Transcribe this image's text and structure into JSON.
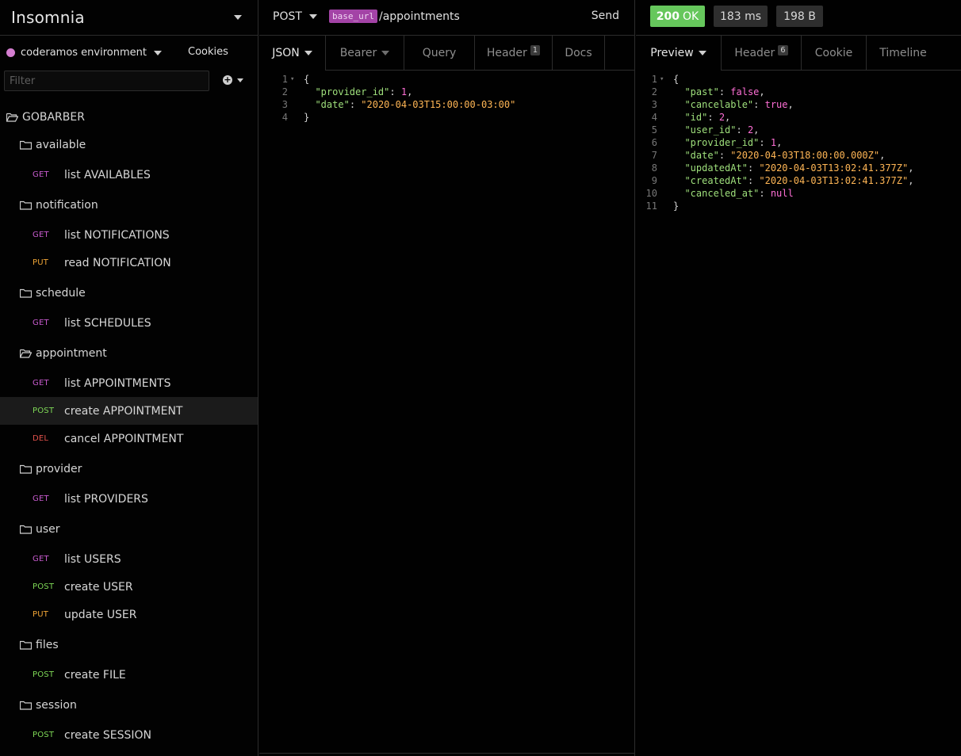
{
  "app": {
    "title": "Insomnia"
  },
  "environment": {
    "name": "coderamos environment",
    "cookies_label": "Cookies",
    "color": "#d47ed0"
  },
  "filter": {
    "placeholder": "Filter"
  },
  "workspace": {
    "name": "GOBARBER"
  },
  "method_colors": {
    "GET": "#c75bce",
    "POST": "#7fd957",
    "PUT": "#f0a536",
    "DEL": "#e2524c"
  },
  "tree": [
    {
      "type": "folder",
      "label": "available",
      "open": false
    },
    {
      "type": "request",
      "method": "GET",
      "label": "list AVAILABLES"
    },
    {
      "type": "folder",
      "label": "notification",
      "open": false
    },
    {
      "type": "request",
      "method": "GET",
      "label": "list NOTIFICATIONS"
    },
    {
      "type": "request",
      "method": "PUT",
      "label": "read NOTIFICATION"
    },
    {
      "type": "folder",
      "label": "schedule",
      "open": false
    },
    {
      "type": "request",
      "method": "GET",
      "label": "list SCHEDULES"
    },
    {
      "type": "folder",
      "label": "appointment",
      "open": true
    },
    {
      "type": "request",
      "method": "GET",
      "label": "list APPOINTMENTS"
    },
    {
      "type": "request",
      "method": "POST",
      "label": "create APPOINTMENT",
      "active": true
    },
    {
      "type": "request",
      "method": "DEL",
      "label": "cancel APPOINTMENT"
    },
    {
      "type": "folder",
      "label": "provider",
      "open": false
    },
    {
      "type": "request",
      "method": "GET",
      "label": "list PROVIDERS"
    },
    {
      "type": "folder",
      "label": "user",
      "open": false
    },
    {
      "type": "request",
      "method": "GET",
      "label": "list USERS"
    },
    {
      "type": "request",
      "method": "POST",
      "label": "create USER"
    },
    {
      "type": "request",
      "method": "PUT",
      "label": "update USER"
    },
    {
      "type": "folder",
      "label": "files",
      "open": false
    },
    {
      "type": "request",
      "method": "POST",
      "label": "create FILE"
    },
    {
      "type": "folder",
      "label": "session",
      "open": false
    },
    {
      "type": "request",
      "method": "POST",
      "label": "create SESSION"
    }
  ],
  "request": {
    "method": "POST",
    "base_url_tag": "base_url",
    "url_path": "/appointments",
    "send_label": "Send",
    "tabs": {
      "body": "JSON",
      "auth": "Bearer",
      "query": "Query",
      "header": "Header",
      "header_count": "1",
      "docs": "Docs"
    },
    "body_lines": [
      [
        [
          "p",
          "{"
        ]
      ],
      [
        [
          "p",
          "  "
        ],
        [
          "k",
          "\"provider_id\""
        ],
        [
          "p",
          ": "
        ],
        [
          "n",
          "1"
        ],
        [
          "p",
          ","
        ]
      ],
      [
        [
          "p",
          "  "
        ],
        [
          "k",
          "\"date\""
        ],
        [
          "p",
          ": "
        ],
        [
          "s",
          "\"2020-04-03T15:00:00-03:00\""
        ]
      ],
      [
        [
          "p",
          "}"
        ]
      ]
    ]
  },
  "response": {
    "status_code": "200",
    "status_text": "OK",
    "time": "183 ms",
    "size": "198 B",
    "tabs": {
      "preview": "Preview",
      "header": "Header",
      "header_count": "6",
      "cookie": "Cookie",
      "timeline": "Timeline"
    },
    "body_lines": [
      [
        [
          "p",
          "{"
        ]
      ],
      [
        [
          "p",
          "  "
        ],
        [
          "k",
          "\"past\""
        ],
        [
          "p",
          ": "
        ],
        [
          "b",
          "false"
        ],
        [
          "p",
          ","
        ]
      ],
      [
        [
          "p",
          "  "
        ],
        [
          "k",
          "\"cancelable\""
        ],
        [
          "p",
          ": "
        ],
        [
          "b",
          "true"
        ],
        [
          "p",
          ","
        ]
      ],
      [
        [
          "p",
          "  "
        ],
        [
          "k",
          "\"id\""
        ],
        [
          "p",
          ": "
        ],
        [
          "n",
          "2"
        ],
        [
          "p",
          ","
        ]
      ],
      [
        [
          "p",
          "  "
        ],
        [
          "k",
          "\"user_id\""
        ],
        [
          "p",
          ": "
        ],
        [
          "n",
          "2"
        ],
        [
          "p",
          ","
        ]
      ],
      [
        [
          "p",
          "  "
        ],
        [
          "k",
          "\"provider_id\""
        ],
        [
          "p",
          ": "
        ],
        [
          "n",
          "1"
        ],
        [
          "p",
          ","
        ]
      ],
      [
        [
          "p",
          "  "
        ],
        [
          "k",
          "\"date\""
        ],
        [
          "p",
          ": "
        ],
        [
          "s",
          "\"2020-04-03T18:00:00.000Z\""
        ],
        [
          "p",
          ","
        ]
      ],
      [
        [
          "p",
          "  "
        ],
        [
          "k",
          "\"updatedAt\""
        ],
        [
          "p",
          ": "
        ],
        [
          "s",
          "\"2020-04-03T13:02:41.377Z\""
        ],
        [
          "p",
          ","
        ]
      ],
      [
        [
          "p",
          "  "
        ],
        [
          "k",
          "\"createdAt\""
        ],
        [
          "p",
          ": "
        ],
        [
          "s",
          "\"2020-04-03T13:02:41.377Z\""
        ],
        [
          "p",
          ","
        ]
      ],
      [
        [
          "p",
          "  "
        ],
        [
          "k",
          "\"canceled_at\""
        ],
        [
          "p",
          ": "
        ],
        [
          "b",
          "null"
        ]
      ],
      [
        [
          "p",
          "}"
        ]
      ]
    ]
  }
}
